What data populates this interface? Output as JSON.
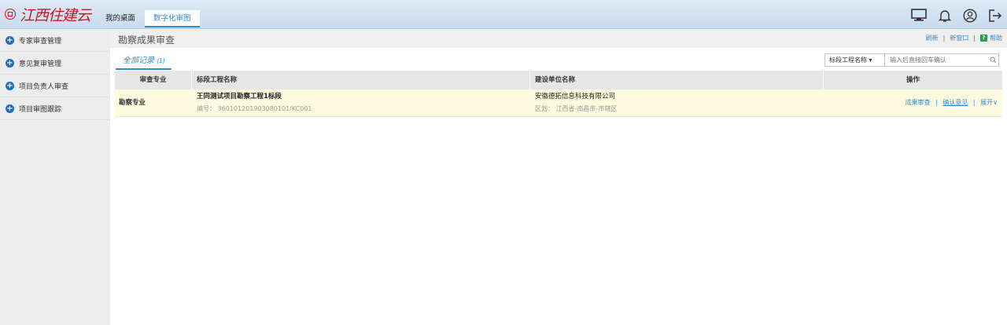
{
  "brand": {
    "name": "江西住建云"
  },
  "top_tabs": [
    {
      "label": "我的桌面"
    },
    {
      "label": "数字化审图"
    }
  ],
  "header_icons": [
    "monitor-icon",
    "bell-icon",
    "user-icon",
    "logout-icon"
  ],
  "sidebar": {
    "items": [
      {
        "label": "专家审查管理"
      },
      {
        "label": "意见复审管理"
      },
      {
        "label": "项目负责人审查"
      },
      {
        "label": "项目审图跟踪"
      }
    ]
  },
  "page": {
    "title": "勘察成果审查",
    "links": {
      "refresh": "刷新",
      "new_window": "新窗口",
      "help": "帮助"
    }
  },
  "filter_tab": {
    "label": "全部记录",
    "count": "(1)"
  },
  "search": {
    "field_label": "标段工程名称",
    "placeholder": "输入后直接回车确认"
  },
  "table": {
    "headers": [
      "审查专业",
      "标段工程名称",
      "建设单位名称",
      "操作"
    ],
    "rows": [
      {
        "discipline": "勘察专业",
        "project_name": "王同测试项目勘察工程1标段",
        "project_code": "编号： 360101201903080101/KC001",
        "unit_name": "安徽德拓信息科技有限公司",
        "region": "区划： 江西省-南昌市-市辖区",
        "actions": {
          "review": "成果审查",
          "confirm": "确认意见",
          "expand": "展开"
        }
      }
    ]
  },
  "colors": {
    "accent": "#2f8bd0",
    "brand_red": "#c8161d",
    "row_highlight": "#fcfbdf",
    "sidebar_bg": "#ececec"
  }
}
